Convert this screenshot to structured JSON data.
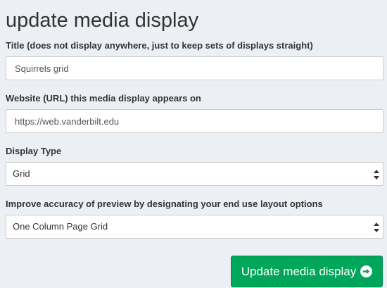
{
  "page": {
    "title": "update media display"
  },
  "form": {
    "title_field": {
      "label": "Title (does not display anywhere, just to keep sets of displays straight)",
      "value": "Squirrels grid"
    },
    "website_field": {
      "label": "Website (URL) this media display appears on",
      "value": "https://web.vanderbilt.edu"
    },
    "display_type_field": {
      "label": "Display Type",
      "selected": "Grid"
    },
    "layout_field": {
      "label": "Improve accuracy of preview by designating your end use layout options",
      "selected": "One Column Page Grid"
    },
    "submit": {
      "label": "Update media display",
      "icon": "arrow-circle-right-icon"
    }
  },
  "colors": {
    "background": "#ecf0f5",
    "button": "#00a65a",
    "button_text": "#ffffff"
  }
}
